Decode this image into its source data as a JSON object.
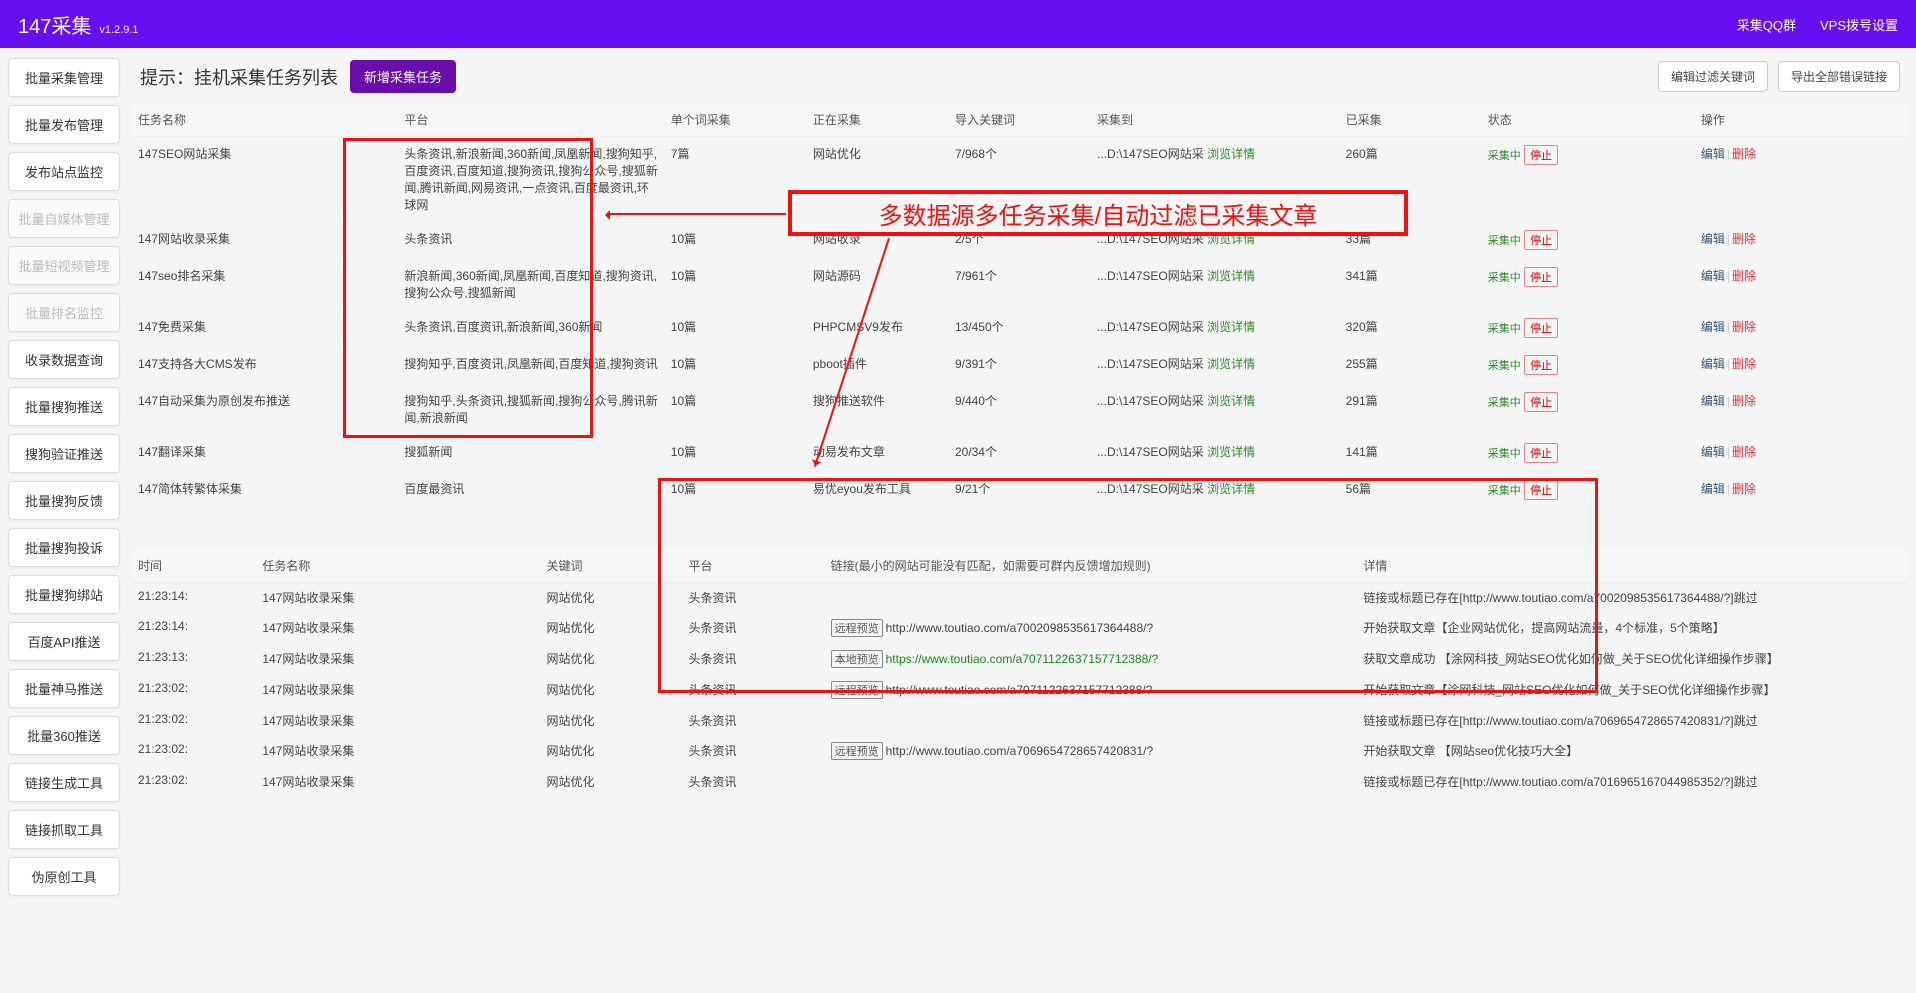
{
  "header": {
    "title": "147采集",
    "version": "v1.2.9.1",
    "links": [
      "采集QQ群",
      "VPS拨号设置"
    ]
  },
  "sidebar": {
    "items": [
      {
        "label": "批量采集管理",
        "disabled": false
      },
      {
        "label": "批量发布管理",
        "disabled": false
      },
      {
        "label": "发布站点监控",
        "disabled": false
      },
      {
        "label": "批量自媒体管理",
        "disabled": true
      },
      {
        "label": "批量短视频管理",
        "disabled": true
      },
      {
        "label": "批量排名监控",
        "disabled": true
      },
      {
        "label": "收录数据查询",
        "disabled": false
      },
      {
        "label": "批量搜狗推送",
        "disabled": false
      },
      {
        "label": "搜狗验证推送",
        "disabled": false
      },
      {
        "label": "批量搜狗反馈",
        "disabled": false
      },
      {
        "label": "批量搜狗投诉",
        "disabled": false
      },
      {
        "label": "批量搜狗绑站",
        "disabled": false
      },
      {
        "label": "百度API推送",
        "disabled": false
      },
      {
        "label": "批量神马推送",
        "disabled": false
      },
      {
        "label": "批量360推送",
        "disabled": false
      },
      {
        "label": "链接生成工具",
        "disabled": false
      },
      {
        "label": "链接抓取工具",
        "disabled": false
      },
      {
        "label": "伪原创工具",
        "disabled": false
      }
    ]
  },
  "panel": {
    "title": "提示：挂机采集任务列表",
    "newTaskBtn": "新增采集任务",
    "filterBtn": "编辑过滤关键词",
    "exportBtn": "导出全部错误链接"
  },
  "tasks": {
    "columns": [
      "任务名称",
      "平台",
      "单个词采集",
      "正在采集",
      "导入关键词",
      "采集到",
      "已采集",
      "状态",
      "操作"
    ],
    "statusLabel": "采集中",
    "stopLabel": "停止",
    "editLabel": "编辑",
    "deleteLabel": "删除",
    "browseLabel": "浏览详情",
    "rows": [
      {
        "name": "147SEO网站采集",
        "platform": "头条资讯,新浪新闻,360新闻,凤凰新闻,搜狗知乎,百度资讯,百度知道,搜狗资讯,搜狗公众号,搜狐新闻,腾讯新闻,网易资讯,一点资讯,百度最资讯,环球网",
        "per": "7篇",
        "current": "网站优化",
        "keywords": "7/968个",
        "dest": "...D:\\147SEO网站采",
        "done": "260篇"
      },
      {
        "name": "147网站收录采集",
        "platform": "头条资讯",
        "per": "10篇",
        "current": "网站收录",
        "keywords": "2/5个",
        "dest": "...D:\\147SEO网站采",
        "done": "33篇"
      },
      {
        "name": "147seo排名采集",
        "platform": "新浪新闻,360新闻,凤凰新闻,百度知道,搜狗资讯,搜狗公众号,搜狐新闻",
        "per": "10篇",
        "current": "网站源码",
        "keywords": "7/961个",
        "dest": "...D:\\147SEO网站采",
        "done": "341篇"
      },
      {
        "name": "147免费采集",
        "platform": "头条资讯,百度资讯,新浪新闻,360新闻",
        "per": "10篇",
        "current": "PHPCMSV9发布",
        "keywords": "13/450个",
        "dest": "...D:\\147SEO网站采",
        "done": "320篇"
      },
      {
        "name": "147支持各大CMS发布",
        "platform": "搜狗知乎,百度资讯,凤凰新闻,百度知道,搜狗资讯",
        "per": "10篇",
        "current": "pboot插件",
        "keywords": "9/391个",
        "dest": "...D:\\147SEO网站采",
        "done": "255篇"
      },
      {
        "name": "147自动采集为原创发布推送",
        "platform": "搜狗知乎,头条资讯,搜狐新闻,搜狗公众号,腾讯新闻,新浪新闻",
        "per": "10篇",
        "current": "搜狗推送软件",
        "keywords": "9/440个",
        "dest": "...D:\\147SEO网站采",
        "done": "291篇"
      },
      {
        "name": "147翻译采集",
        "platform": "搜狐新闻",
        "per": "10篇",
        "current": "动易发布文章",
        "keywords": "20/34个",
        "dest": "...D:\\147SEO网站采",
        "done": "141篇"
      },
      {
        "name": "147简体转繁体采集",
        "platform": "百度最资讯",
        "per": "10篇",
        "current": "易优eyou发布工具",
        "keywords": "9/21个",
        "dest": "...D:\\147SEO网站采",
        "done": "56篇"
      }
    ]
  },
  "log": {
    "columns": [
      "时间",
      "任务名称",
      "关键词",
      "平台",
      "链接(最小的网站可能没有匹配，如需要可群内反馈增加规则)",
      "详情"
    ],
    "remoteBadge": "远程预览",
    "localBadge": "本地预览",
    "rows": [
      {
        "time": "21:23:14:",
        "task": "147网站收录采集",
        "kw": "网站优化",
        "plat": "头条资讯",
        "linkType": "",
        "url": "",
        "detail": "链接或标题已存在[http://www.toutiao.com/a7002098535617364488/?]跳过"
      },
      {
        "time": "21:23:14:",
        "task": "147网站收录采集",
        "kw": "网站优化",
        "plat": "头条资讯",
        "linkType": "remote",
        "url": "http://www.toutiao.com/a7002098535617364488/?",
        "detail": "开始获取文章【企业网站优化，提高网站流量，4个标准，5个策略】"
      },
      {
        "time": "21:23:13:",
        "task": "147网站收录采集",
        "kw": "网站优化",
        "plat": "头条资讯",
        "linkType": "local",
        "url": "https://www.toutiao.com/a7071122637157712388/?",
        "detail": "获取文章成功 【涂网科技_网站SEO优化如何做_关于SEO优化详细操作步骤】"
      },
      {
        "time": "21:23:02:",
        "task": "147网站收录采集",
        "kw": "网站优化",
        "plat": "头条资讯",
        "linkType": "remote",
        "url": "http://www.toutiao.com/a7071122637157712388/?",
        "detail": "开始获取文章【涂网科技_网站SEO优化如何做_关于SEO优化详细操作步骤】"
      },
      {
        "time": "21:23:02:",
        "task": "147网站收录采集",
        "kw": "网站优化",
        "plat": "头条资讯",
        "linkType": "",
        "url": "",
        "detail": "链接或标题已存在[http://www.toutiao.com/a7069654728657420831/?]跳过"
      },
      {
        "time": "21:23:02:",
        "task": "147网站收录采集",
        "kw": "网站优化",
        "plat": "头条资讯",
        "linkType": "remote",
        "url": "http://www.toutiao.com/a7069654728657420831/?",
        "detail": "开始获取文章 【网站seo优化技巧大全】"
      },
      {
        "time": "21:23:02:",
        "task": "147网站收录采集",
        "kw": "网站优化",
        "plat": "头条资讯",
        "linkType": "",
        "url": "",
        "detail": "链接或标题已存在[http://www.toutiao.com/a7016965167044985352/?]跳过"
      }
    ]
  },
  "annotation": {
    "callout": "多数据源多任务采集/自动过滤已采集文章"
  }
}
